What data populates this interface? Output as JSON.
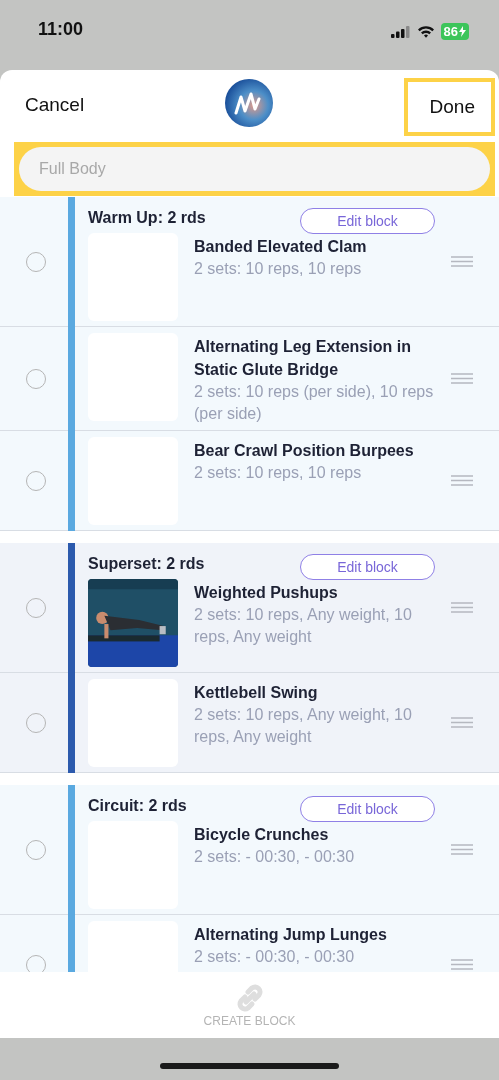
{
  "status_bar": {
    "time": "11:00",
    "battery": "86"
  },
  "header": {
    "cancel": "Cancel",
    "done": "Done",
    "highlighted": true
  },
  "search": {
    "placeholder": "Full Body",
    "highlighted": true
  },
  "blocks": [
    {
      "title": "Warm Up: 2 rds",
      "edit": "Edit block",
      "color": "#5aa9e0",
      "exercises": [
        {
          "name": "Banded Elevated Clam",
          "detail": "2 sets: 10 reps, 10 reps",
          "selected": false
        },
        {
          "name": "Alternating Leg Extension in Static Glute Bridge",
          "detail": "2 sets: 10 reps (per side), 10 reps (per side)",
          "selected": false
        },
        {
          "name": "Bear Crawl Position Burpees",
          "detail": "2 sets: 10 reps, 10 reps",
          "selected": false
        }
      ]
    },
    {
      "title": "Superset: 2 rds",
      "edit": "Edit block",
      "color": "#2c5aad",
      "exercises": [
        {
          "name": "Weighted Pushups",
          "detail": "2 sets: 10 reps, Any weight, 10 reps, Any weight",
          "selected": false
        },
        {
          "name": "Kettlebell Swing",
          "detail": "2 sets: 10 reps, Any weight, 10 reps, Any weight",
          "selected": false
        }
      ]
    },
    {
      "title": "Circuit: 2 rds",
      "edit": "Edit block",
      "color": "#5aa9e0",
      "exercises": [
        {
          "name": "Bicycle Crunches",
          "detail": "2 sets: - 00:30, - 00:30",
          "selected": false
        },
        {
          "name": "Alternating Jump Lunges",
          "detail": "2 sets: - 00:30, - 00:30",
          "selected": false
        }
      ]
    }
  ],
  "footer": {
    "label": "CREATE BLOCK",
    "disabled": true
  }
}
